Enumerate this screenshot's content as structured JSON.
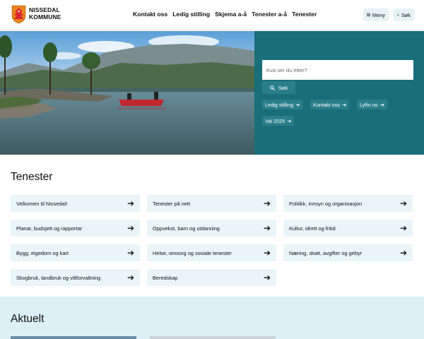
{
  "header": {
    "logo_line1": "NISSEDAL",
    "logo_line2": "KOMMUNE",
    "nav": [
      "Kontakt oss",
      "Ledig stilling",
      "Skjema a-å",
      "Tenester a-å",
      "Tenester"
    ],
    "menu_label": "Meny",
    "search_label": "Søk",
    "menu_icon": "hamburger-icon",
    "search_icon": "magnifier-icon"
  },
  "hero": {
    "search_placeholder": "Kva ser du etter?",
    "search_button": "Søk",
    "quick_links": [
      "Ledig stilling",
      "Kontakt oss",
      "Lyftn.no",
      "Val 2025"
    ]
  },
  "tenester": {
    "title": "Tenester",
    "items": [
      "Velkomen til Nissedal!",
      "Tenester på nett",
      "Politikk, innsyn og organisasjon",
      "Planar, budsjett og rapportar",
      "Oppvekst, barn og utdanning",
      "Kultur, idrett og fritid",
      "Bygg, eigedom og kart",
      "Helse, omsorg og sosiale tenester",
      "Næring, skatt, avgifter og gebyr",
      "Skogbruk, landbruk og viltforvaltning",
      "Beredskap"
    ]
  },
  "aktuelt": {
    "title": "Aktuelt"
  },
  "colors": {
    "accent": "#196e7a",
    "card_bg": "#e9f5f8",
    "aktuelt_bg": "#ddf0f6",
    "logo_orange": "#e8831e",
    "logo_red": "#d8262d"
  }
}
